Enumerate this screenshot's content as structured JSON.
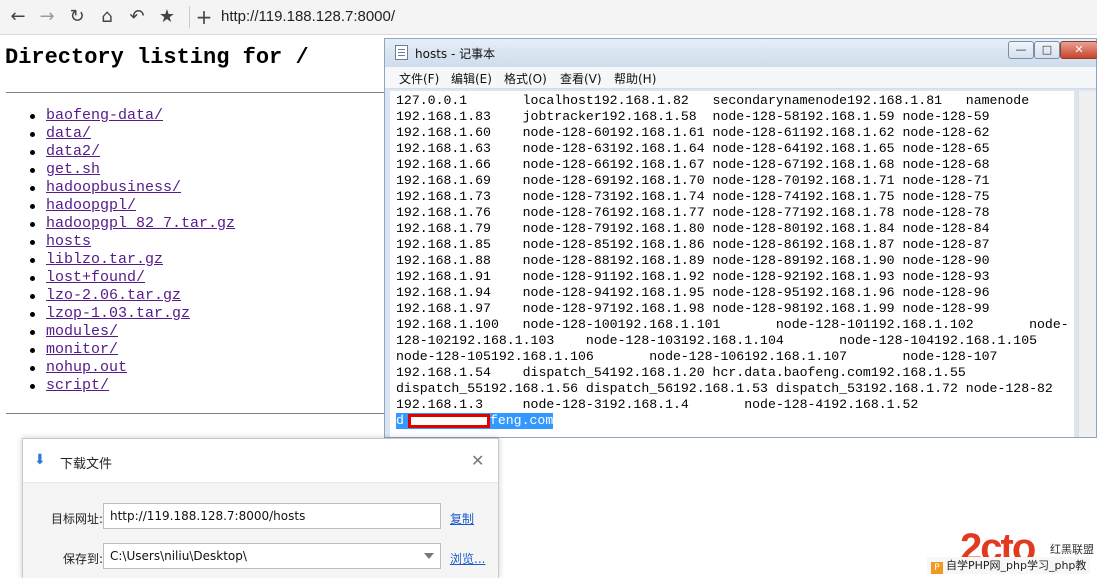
{
  "browser": {
    "address": "http://119.188.128.7:8000/"
  },
  "page": {
    "title": "Directory listing for /",
    "entries": [
      "baofeng-data/",
      "data/",
      "data2/",
      "get.sh",
      "hadoopbusiness/",
      "hadoopgpl/",
      "hadoopgpl_82_7.tar.gz",
      "hosts",
      "liblzo.tar.gz",
      "lost+found/",
      "lzo-2.06.tar.gz",
      "lzop-1.03.tar.gz",
      "modules/",
      "monitor/",
      "nohup.out",
      "script/"
    ]
  },
  "notepad": {
    "title": "hosts - 记事本",
    "menu": [
      "文件(F)",
      "编辑(E)",
      "格式(O)",
      "查看(V)",
      "帮助(H)"
    ],
    "lines": [
      "127.0.0.1       localhost192.168.1.82   secondarynamenode192.168.1.81   namenode",
      "192.168.1.83    jobtracker192.168.1.58  node-128-58192.168.1.59 node-128-59",
      "192.168.1.60    node-128-60192.168.1.61 node-128-61192.168.1.62 node-128-62",
      "192.168.1.63    node-128-63192.168.1.64 node-128-64192.168.1.65 node-128-65",
      "192.168.1.66    node-128-66192.168.1.67 node-128-67192.168.1.68 node-128-68",
      "192.168.1.69    node-128-69192.168.1.70 node-128-70192.168.1.71 node-128-71",
      "192.168.1.73    node-128-73192.168.1.74 node-128-74192.168.1.75 node-128-75",
      "192.168.1.76    node-128-76192.168.1.77 node-128-77192.168.1.78 node-128-78",
      "192.168.1.79    node-128-79192.168.1.80 node-128-80192.168.1.84 node-128-84",
      "192.168.1.85    node-128-85192.168.1.86 node-128-86192.168.1.87 node-128-87",
      "192.168.1.88    node-128-88192.168.1.89 node-128-89192.168.1.90 node-128-90",
      "192.168.1.91    node-128-91192.168.1.92 node-128-92192.168.1.93 node-128-93",
      "192.168.1.94    node-128-94192.168.1.95 node-128-95192.168.1.96 node-128-96",
      "192.168.1.97    node-128-97192.168.1.98 node-128-98192.168.1.99 node-128-99",
      "192.168.1.100   node-128-100192.168.1.101       node-128-101192.168.1.102       node-",
      "128-102192.168.1.103    node-128-103192.168.1.104       node-128-104192.168.1.105",
      "node-128-105192.168.1.106       node-128-106192.168.1.107       node-128-107",
      "192.168.1.54    dispatch_54192.168.1.20 hcr.data.baofeng.com192.168.1.55",
      "dispatch_55192.168.1.56 dispatch_56192.168.1.53 dispatch_53192.168.1.72 node-128-82",
      "192.168.1.3     node-128-3192.168.1.4       node-128-4192.168.1.52"
    ],
    "selected_line_prefix": "d",
    "selected_line_suffix": "feng.com"
  },
  "download_dialog": {
    "title": "下载文件",
    "target_label": "目标网址:",
    "target_value": "http://119.188.128.7:8000/hosts",
    "copy_link": "复制",
    "save_label": "保存到:",
    "save_value": "C:\\Users\\niliu\\Desktop\\",
    "browse_link": "浏览..."
  },
  "watermark": {
    "side_text": "红黑联盟",
    "bar_text": "自学PHP网_php学习_php教"
  }
}
